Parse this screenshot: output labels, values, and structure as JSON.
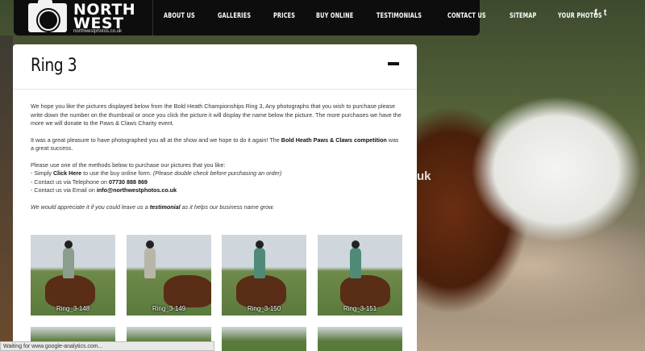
{
  "site": {
    "logo": {
      "line1": "NORTH",
      "line2": "WEST",
      "url": "northwestphotos.co.uk"
    },
    "nav": [
      "ABOUT US",
      "GALLERIES",
      "PRICES",
      "BUY ONLINE",
      "TESTIMONIALS",
      "CONTACT US",
      "SITEMAP",
      "YOUR PHOTOS"
    ],
    "social": {
      "facebook": "f",
      "twitter": "t"
    }
  },
  "page": {
    "title": "Ring 3",
    "intro": "We hope you like the pictures displayed below from the Bold Heath Championships Ring 3, Any photographs that you wish to purchase please write down the number on the thumbnail or once you click the picture it will display the name below the picture. The more purchases we have the more we will donate to the Paws & Claws Charity event.",
    "pleasure_pre": "It was a great pleasure to have photographed you all at the show and we hope to do it again! The ",
    "pleasure_bold": "Bold Heath Paws & Claws competition",
    "pleasure_post": " was a great success.",
    "methods_heading": "Please use one of the methods below to purchase our pictures that you like:",
    "method1_pre": "- Simply ",
    "method1_link": "Click Here",
    "method1_mid": " to use the buy online form. ",
    "method1_note": "(Please double check before purchasing an order)",
    "method2_pre": "- Contact us via Telephone on ",
    "method2_phone": "07730 888 869",
    "method3_pre": "- Contact us via Email on ",
    "method3_email": "info@northwestphotos.co.uk",
    "testimonial_pre": "We would appreciate it if you could leave us a ",
    "testimonial_link": "testimonial",
    "testimonial_post": " as it helps our business name grow."
  },
  "thumbnails": [
    {
      "caption": "Ring_3-148"
    },
    {
      "caption": "Ring_3-149"
    },
    {
      "caption": "Ring_3-150"
    },
    {
      "caption": "Ring_3-151"
    }
  ],
  "background": {
    "partial_text": "uk"
  },
  "status": {
    "text": "Waiting for www.google-analytics.com..."
  },
  "colors": {
    "nav_bg": "#0d0d0d",
    "panel_bg": "#ffffff",
    "text": "#333333"
  }
}
